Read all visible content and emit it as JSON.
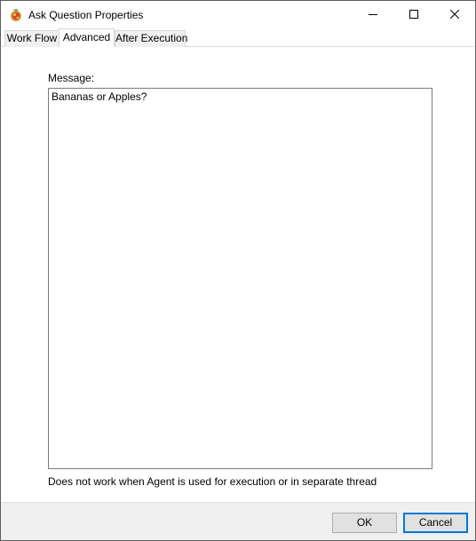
{
  "window": {
    "title": "Ask Question Properties",
    "icon": "app-logo-icon"
  },
  "caption_buttons": [
    "minimize-icon",
    "maximize-icon",
    "close-icon"
  ],
  "tabs": [
    {
      "label": "Work Flow",
      "selected": false
    },
    {
      "label": "Advanced",
      "selected": true
    },
    {
      "label": "After Execution",
      "selected": false
    }
  ],
  "advanced": {
    "message_label": "Message:",
    "message_value": "Bananas or Apples?",
    "note": "Does not work when Agent is used for execution or in separate thread"
  },
  "footer": {
    "ok_label": "OK",
    "cancel_label": "Cancel"
  },
  "colors": {
    "accent": "#0078d7",
    "footer_bg": "#f0f0f0",
    "button_bg": "#e1e1e1"
  }
}
